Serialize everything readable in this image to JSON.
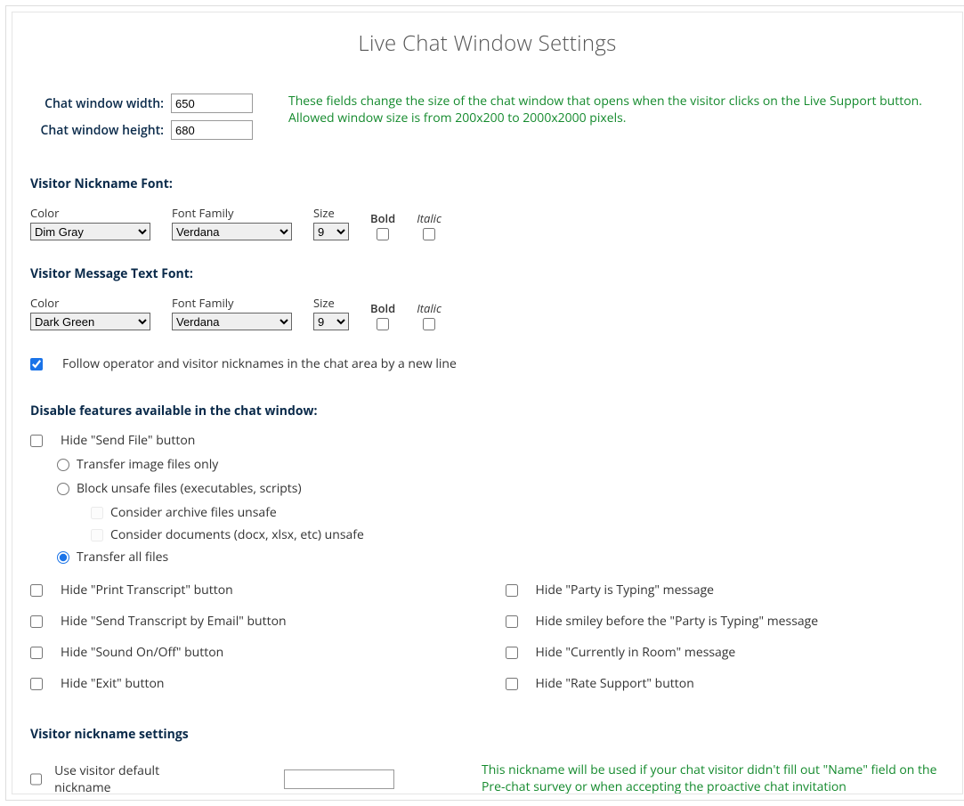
{
  "title": "Live Chat Window Settings",
  "size": {
    "width_label": "Chat window width:",
    "width_value": "650",
    "height_label": "Chat window height:",
    "height_value": "680",
    "help": "These fields change the size of the chat window that opens when the visitor clicks on the Live Support button. Allowed window size is from 200x200 to 2000x2000 pixels."
  },
  "visitor_nick_font": {
    "heading": "Visitor Nickname Font:",
    "color_label": "Color",
    "color_value": "Dim Gray",
    "family_label": "Font Family",
    "family_value": "Verdana",
    "size_label": "Size",
    "size_value": "9",
    "bold_label": "Bold",
    "italic_label": "Italic"
  },
  "visitor_msg_font": {
    "heading": "Visitor Message Text Font:",
    "color_label": "Color",
    "color_value": "Dark Green",
    "family_label": "Font Family",
    "family_value": "Verdana",
    "size_label": "Size",
    "size_value": "9",
    "bold_label": "Bold",
    "italic_label": "Italic"
  },
  "follow_newline": {
    "label": "Follow operator and visitor nicknames in the chat area by a new line",
    "checked": true
  },
  "disable_heading": "Disable features available in the chat window:",
  "hide_send_file": "Hide \"Send File\" button",
  "transfer_options": {
    "image_only": "Transfer image files only",
    "block_unsafe": "Block unsafe files (executables, scripts)",
    "archive_unsafe": "Consider archive files unsafe",
    "docs_unsafe": "Consider documents (docx, xlsx, etc) unsafe",
    "all": "Transfer all files"
  },
  "left_opts": {
    "print": "Hide \"Print Transcript\" button",
    "email": "Hide \"Send Transcript by Email\" button",
    "sound": "Hide \"Sound On/Off\" button",
    "exit": "Hide \"Exit\" button"
  },
  "right_opts": {
    "typing": "Hide \"Party is Typing\" message",
    "smiley": "Hide smiley before the \"Party is Typing\" message",
    "inroom": "Hide \"Currently in Room\" message",
    "rate": "Hide \"Rate Support\" button"
  },
  "nickname": {
    "heading": "Visitor nickname settings",
    "use_default": "Use visitor default nickname",
    "value": "",
    "help": "This nickname will be used if your chat visitor didn't fill out \"Name\" field on the Pre-chat survey or when accepting the proactive chat invitation"
  }
}
